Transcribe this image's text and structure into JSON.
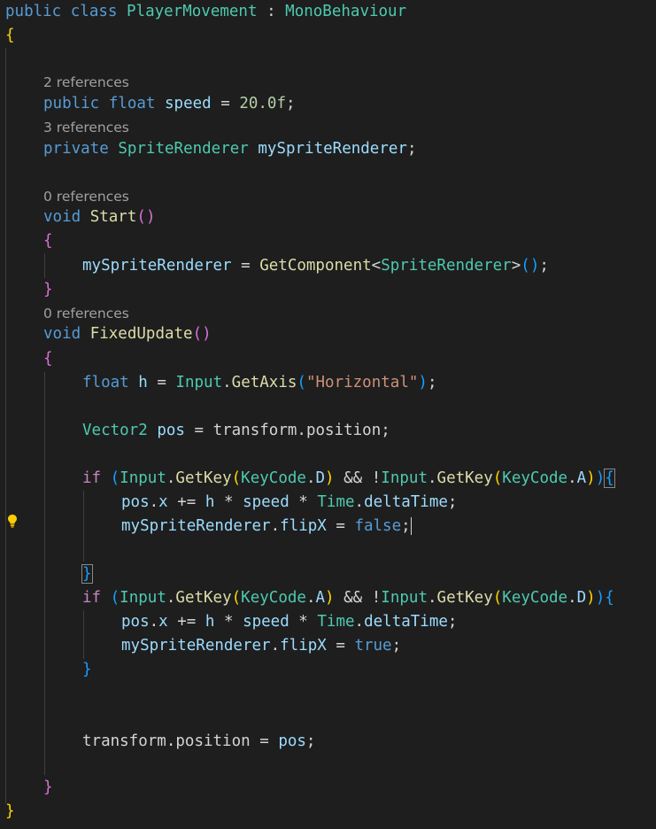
{
  "tokens": {
    "public": "public",
    "class": "class",
    "class_name": "PlayerMovement",
    "colon": ":",
    "base_class": "MonoBehaviour",
    "open_brace": "{",
    "close_brace": "}",
    "float": "float",
    "speed": "speed",
    "eq": "=",
    "speed_value": "20.0f",
    "semi": ";",
    "private": "private",
    "sprite_renderer": "SpriteRenderer",
    "my_sprite_renderer": "mySpriteRenderer",
    "void": "void",
    "start": "Start",
    "paren_open": "(",
    "paren_close": ")",
    "get_component": "GetComponent",
    "lt": "<",
    "gt": ">",
    "fixed_update": "FixedUpdate",
    "h": "h",
    "input": "Input",
    "dot": ".",
    "get_axis": "GetAxis",
    "horizontal_str": "\"Horizontal\"",
    "vector2": "Vector2",
    "pos": "pos",
    "transform": "transform",
    "position": "position",
    "if": "if",
    "get_key": "GetKey",
    "keycode": "KeyCode",
    "key_d": "D",
    "key_a": "A",
    "and": "&&",
    "not": "!",
    "x": "x",
    "plus_eq": "+=",
    "star": "*",
    "time": "Time",
    "delta_time": "deltaTime",
    "flip_x": "flipX",
    "false": "false",
    "true": "true"
  },
  "lens": {
    "l1": "2 references",
    "l2": "3 references",
    "l3": "0 references",
    "l4": "0 references"
  },
  "icons": {
    "lightbulb": "lightbulb-icon"
  },
  "colors": {
    "background": "#1e1e1e",
    "keyword": "#569cd6",
    "type": "#4ec9b0",
    "function": "#dcdcaa",
    "variable": "#9cdcfe",
    "number": "#b5cea8",
    "string": "#ce9178",
    "control": "#c586c0"
  }
}
